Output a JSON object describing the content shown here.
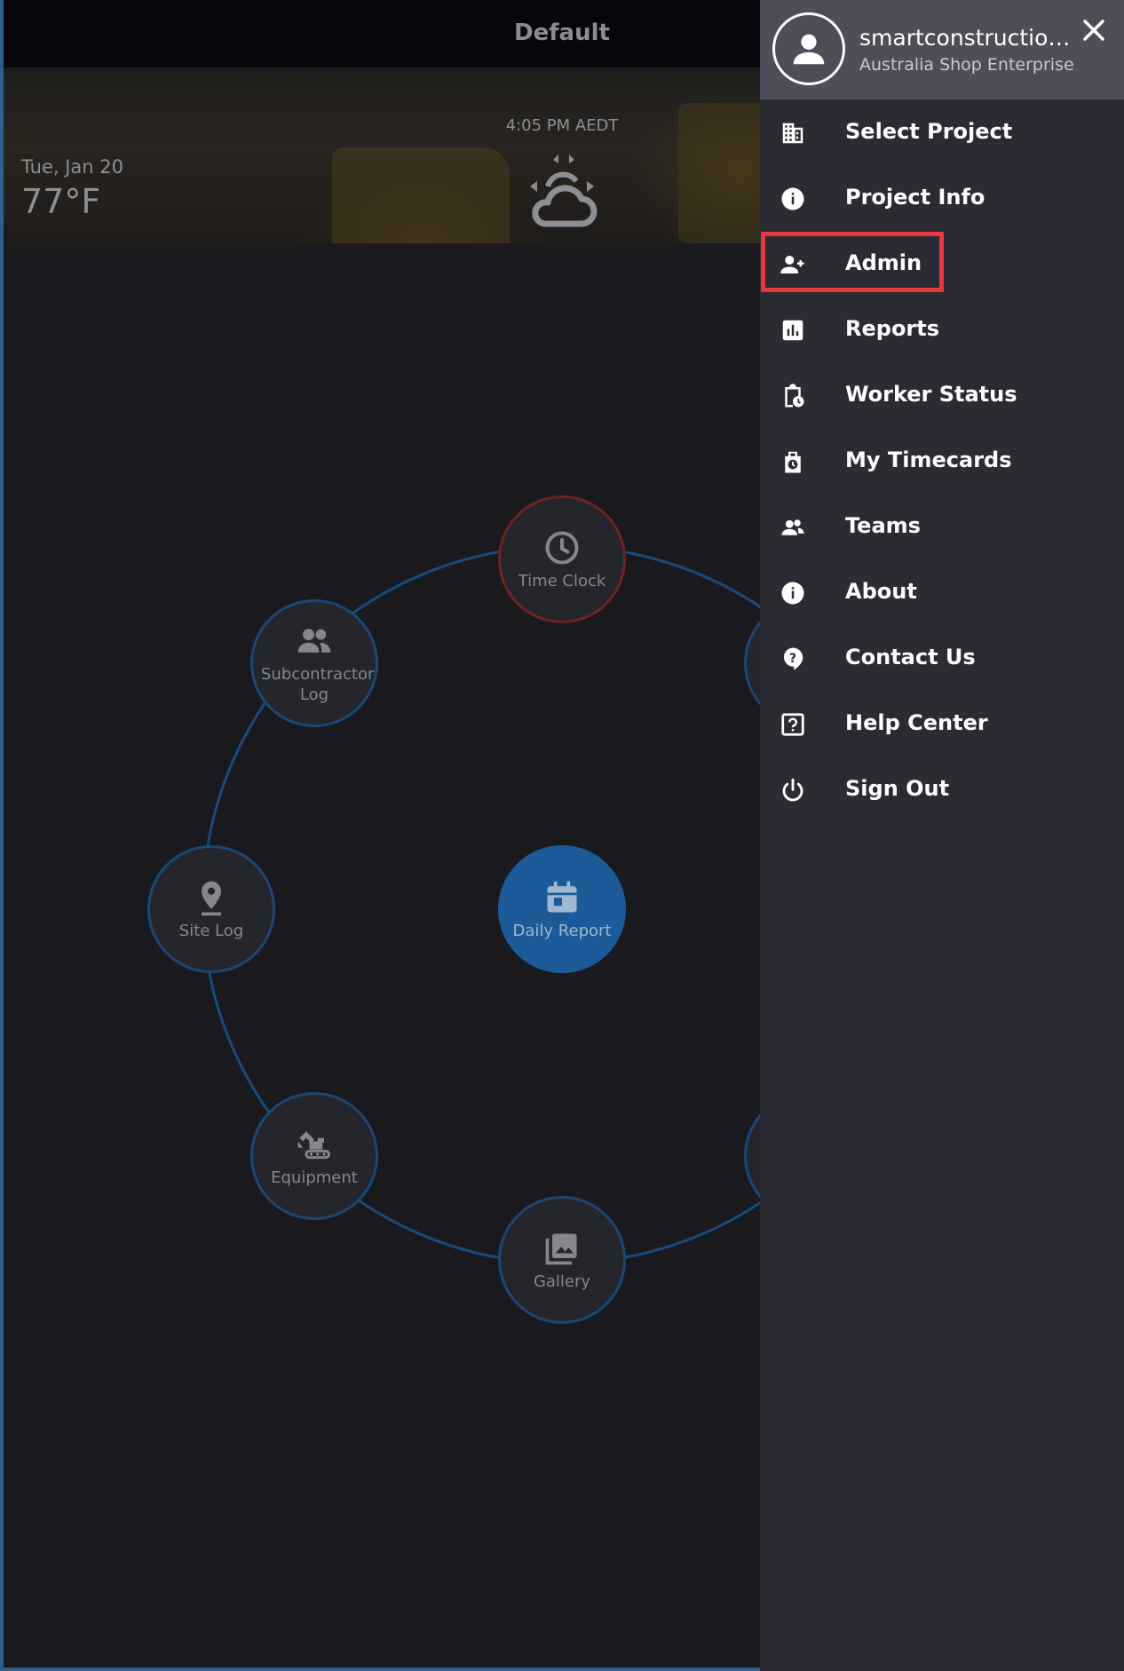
{
  "header": {
    "title": "Default"
  },
  "weather": {
    "date": "Tue, Jan 20",
    "temperature": "77°F",
    "time": "4:05 PM AEDT",
    "icon": "partly-cloudy-icon"
  },
  "hub": {
    "nodes": [
      {
        "label": "Time Clock",
        "icon": "clock-icon"
      },
      {
        "label": "Subcontractor Log",
        "icon": "people-icon"
      },
      {
        "label": "Site Log",
        "icon": "location-pin-icon"
      },
      {
        "label": "Equipment",
        "icon": "excavator-icon"
      },
      {
        "label": "Gallery",
        "icon": "gallery-icon"
      },
      {
        "label": "Daily Report",
        "icon": "calendar-icon"
      }
    ]
  },
  "drawer": {
    "user": {
      "name": "smartconstructioneb...",
      "organization": "Australia Shop Enterprise"
    },
    "items": [
      {
        "label": "Select Project",
        "icon": "building-icon"
      },
      {
        "label": "Project Info",
        "icon": "info-icon"
      },
      {
        "label": "Admin",
        "icon": "add-person-icon"
      },
      {
        "label": "Reports",
        "icon": "bar-chart-icon"
      },
      {
        "label": "Worker Status",
        "icon": "clipboard-clock-icon"
      },
      {
        "label": "My Timecards",
        "icon": "timecard-icon"
      },
      {
        "label": "Teams",
        "icon": "team-icon"
      },
      {
        "label": "About",
        "icon": "info-icon"
      },
      {
        "label": "Contact Us",
        "icon": "help-bubble-icon"
      },
      {
        "label": "Help Center",
        "icon": "help-box-icon"
      },
      {
        "label": "Sign Out",
        "icon": "power-icon"
      }
    ]
  },
  "colors": {
    "accent": "#1c5b98",
    "highlight": "#e8383e",
    "drawer_bg": "#2a2b33"
  }
}
